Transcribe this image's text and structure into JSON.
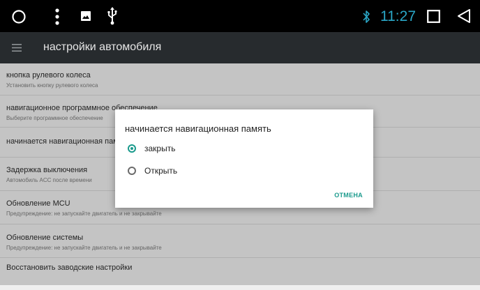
{
  "status_bar": {
    "time": "11:27",
    "icons": [
      "circle-icon",
      "more-vert-icon",
      "image-icon",
      "usb-icon",
      "bluetooth-icon",
      "recents-icon",
      "back-icon"
    ],
    "accent_color": "#2aa6c6"
  },
  "toolbar": {
    "title": "настройки автомобиля",
    "menu_icon": "menu-icon"
  },
  "list": {
    "items": [
      {
        "title": "кнопка рулевого колеса",
        "subtitle": "Установить кнопку рулевого колеса"
      },
      {
        "title": "навигационное программное обеспечение",
        "subtitle": "Выберите программное обеспечение"
      },
      {
        "title": "начинается навигационная память",
        "subtitle": ""
      },
      {
        "title": "Задержка выключения",
        "subtitle": "Автомобиль ACC после времени"
      },
      {
        "title": "Обновление MCU",
        "subtitle": "Предупреждение: не запускайте двигатель и не закрывайте"
      },
      {
        "title": "Обновление системы",
        "subtitle": "Предупреждение: не запускайте двигатель и не закрывайте"
      },
      {
        "title": "Восстановить заводские настройки",
        "subtitle": ""
      }
    ]
  },
  "dialog": {
    "title": "начинается навигационная память",
    "options": [
      {
        "label": "закрыть",
        "selected": true
      },
      {
        "label": "Открыть",
        "selected": false
      }
    ],
    "cancel_label": "ОТМЕНА",
    "accent_color": "#1a9a8c"
  }
}
